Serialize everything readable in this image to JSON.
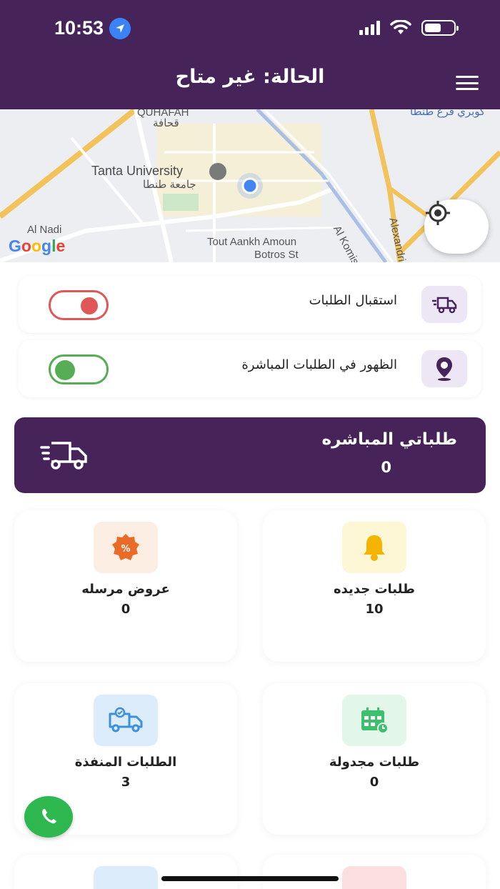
{
  "status_bar": {
    "time": "10:53"
  },
  "header": {
    "title": "الحالة: غير متاح"
  },
  "map": {
    "labels": {
      "quhafah": "QUHAFAH",
      "quhafah_ar": "قحافة",
      "tanta_university": "Tanta University",
      "tanta_university_ar": "جامعة طنطا",
      "al_nadi": "Al Nadi",
      "tout": "Tout Aankh Amoun",
      "botros": "Botros St",
      "al_komish": "Al Komish",
      "alexandria": "Alexandri",
      "top_right_ar": "كوبري فرع طنطا"
    },
    "google": "Google"
  },
  "toggles": [
    {
      "label": "استقبال الطلبات",
      "state": "off",
      "icon": "truck-icon"
    },
    {
      "label": "الظهور في الطلبات المباشرة",
      "state": "on",
      "icon": "location-pin-icon"
    }
  ],
  "banner": {
    "title": "طلباتي المباشره",
    "count": "0",
    "icon": "fast-truck-icon"
  },
  "cards": [
    {
      "label": "طلبات جديده",
      "count": "10",
      "icon": "bell-icon",
      "bg": "#fdf7d6",
      "color": "#f4b400"
    },
    {
      "label": "عروض مرسله",
      "count": "0",
      "icon": "discount-badge-icon",
      "bg": "#fceee3",
      "color": "#ea6a27"
    },
    {
      "label": "طلبات مجدولة",
      "count": "0",
      "icon": "calendar-icon",
      "bg": "#e2f7ea",
      "color": "#3cc06e"
    },
    {
      "label": "الطلبات المنفذة",
      "count": "3",
      "icon": "delivery-truck-icon",
      "bg": "#dcecfb",
      "color": "#3d8fe0"
    }
  ],
  "colors": {
    "primary": "#46245a",
    "toggle_off": "#e05757",
    "toggle_on": "#56ad56"
  }
}
